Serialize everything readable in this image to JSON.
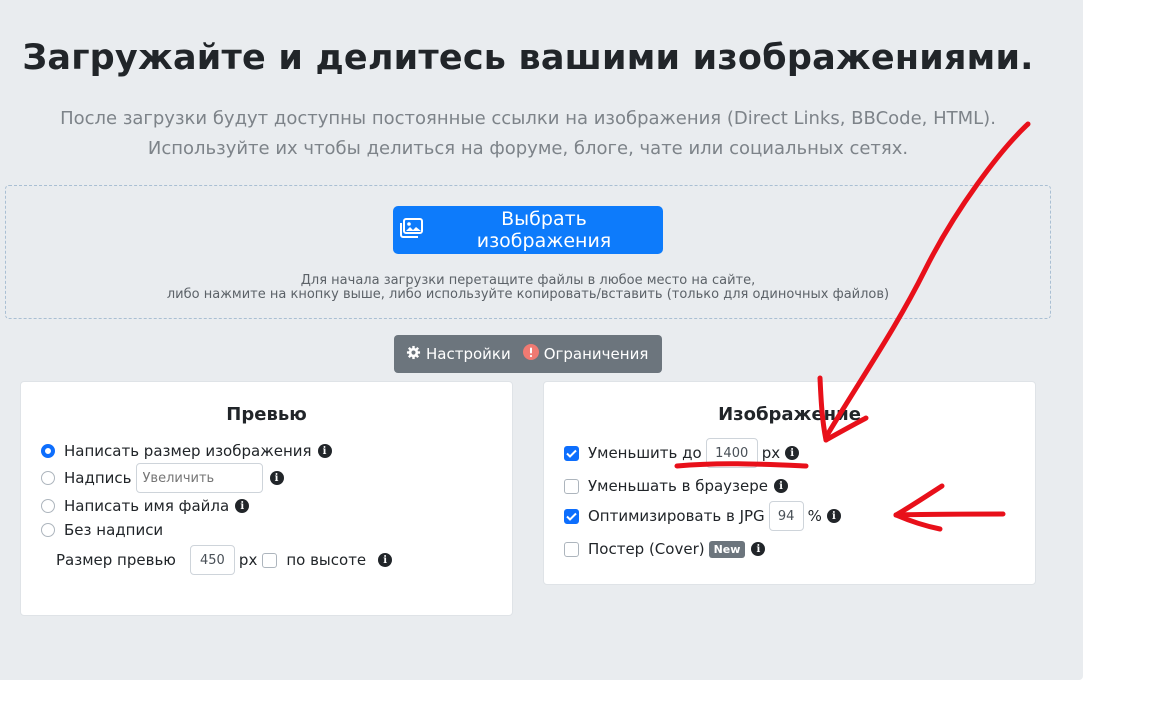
{
  "header": {
    "title": "Загружайте и делитесь вашими изображениями.",
    "subtitle_line1": "После загрузки будут доступны постоянные ссылки на изображения (Direct Links, BBCode, HTML).",
    "subtitle_line2": "Используйте их чтобы делиться на форуме, блоге, чате или социальных сетях."
  },
  "upload": {
    "button_label": "Выбрать изображения",
    "hint_line1": "Для начала загрузки перетащите файлы в любое место на сайте,",
    "hint_line2": "либо нажмите на кнопку выше, либо используйте копировать/вставить (только для одиночных файлов)"
  },
  "tabs": {
    "settings": "Настройки",
    "limits": "Ограничения"
  },
  "preview": {
    "title": "Превью",
    "options": [
      {
        "label": "Написать размер изображения",
        "selected": true
      },
      {
        "label": "Надпись",
        "selected": false
      },
      {
        "label": "Написать имя файла",
        "selected": false
      },
      {
        "label": "Без надписи",
        "selected": false
      }
    ],
    "caption_placeholder": "Увеличить",
    "size_label": "Размер превью",
    "size_value": "450",
    "size_unit": "px",
    "by_height_label": "по высоте",
    "by_height_checked": false
  },
  "image": {
    "title": "Изображение",
    "resize_label": "Уменьшить до",
    "resize_checked": true,
    "resize_value": "1400",
    "resize_unit": "px",
    "browser_resize_label": "Уменьшать в браузере",
    "browser_resize_checked": false,
    "optimize_label": "Оптимизировать в JPG",
    "optimize_checked": true,
    "optimize_value": "94",
    "optimize_unit": "%",
    "poster_label": "Постер (Cover)",
    "poster_checked": false,
    "poster_badge": "New"
  },
  "colors": {
    "accent": "#0d7bfb",
    "annotation": "#e8101a",
    "background": "#e9ecef"
  }
}
